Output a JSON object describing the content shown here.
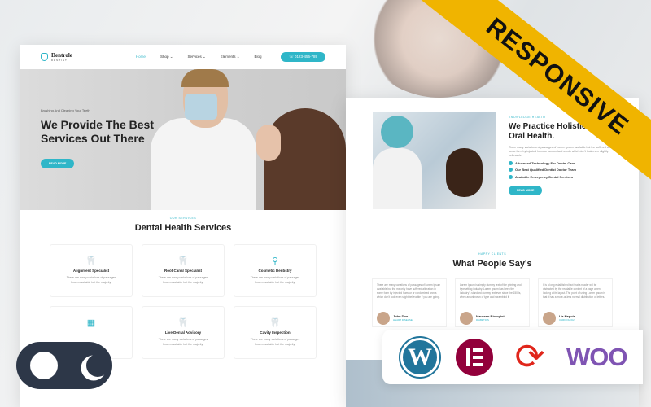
{
  "left_screen": {
    "logo": {
      "name": "Dentrole",
      "sub": "DENTIST"
    },
    "nav": [
      "Home",
      "Shop ⌄",
      "Services ⌄",
      "Elements ⌄",
      "Blog"
    ],
    "phone": "☏ 0123-456-789",
    "hero": {
      "kicker": "Brushing And Cleaning Your Teeth",
      "title": "We Provide The Best Services Out There",
      "button": "READ MORE"
    },
    "services": {
      "tag": "OUR SERVICES",
      "title": "Dental Health Services",
      "items": [
        {
          "icon": "tooth-check-icon",
          "title": "Alignment Specialist",
          "text": "There are many variations of passages Ipsum available but the majority."
        },
        {
          "icon": "tooth-icon",
          "title": "Root Canal Specialist",
          "text": "There are many variations of passages Ipsum available but the majority."
        },
        {
          "icon": "dental-tools-icon",
          "title": "Cosmetic Dentistry",
          "text": "There are many variations of passages Ipsum available but the majority."
        },
        {
          "icon": "dental-kit-icon",
          "title": "",
          "text": ""
        },
        {
          "icon": "tooth-advisory-icon",
          "title": "Live Dental Advisory",
          "text": "There are many variations of passages Ipsum available but the majority."
        },
        {
          "icon": "tooth-cavity-icon",
          "title": "Cavity Inspection",
          "text": "There are many variations of passages Ipsum available but the majority."
        }
      ]
    }
  },
  "right_screen": {
    "about": {
      "tag": "KNOWLEDGE HEALTH",
      "title": "We Practice Holistic And See Oral Health.",
      "text": "There many variations of passages of Lorem Ipsum available but the suffered alteration in some form by injected humour randomised words which don't look even slightly believable.",
      "list": [
        "Advanced Technology For Dental Care",
        "Our Best Qualified Dentist Doctor Team",
        "Available Emergency Dental Services"
      ],
      "button": "READ MORE"
    },
    "testimonials": {
      "tag": "HAPPY CLIENTS",
      "title": "What People Say's",
      "items": [
        {
          "text": "There are many variations of passages of Lorem Ipsum available but the majority have suffered alteration in some form by injected humour or randomised words which don't look even slight believable if you are going.",
          "name": "John Doe",
          "role": "HEART DISEASE"
        },
        {
          "text": "Lorem Ipsum is simply dummy text of the printing and typesetting industry. Lorem Ipsum has been the industry's standard dummy text ever since the 1500s, when an unknown of type and scrambled it.",
          "name": "Maureen Biologist",
          "role": "DIABETICS"
        },
        {
          "text": "It is a long established fact that a reader will be distracted by the readable content of a page when looking at its layout. The point of using Lorem Ipsum is that it has a more-or-less normal distribution of letters.",
          "name": "Liz Napoin",
          "role": "CARDIOLOGY"
        }
      ]
    }
  },
  "ribbon": "RESPONSIVE",
  "plugins": [
    "WordPress",
    "Elementor",
    "Sync",
    "Woo"
  ],
  "plugins_text": {
    "wp": "W",
    "woo": "WOO"
  },
  "colors": {
    "accent": "#2fb6c8",
    "ribbon": "#f0b400",
    "toggle": "#2d3748"
  }
}
